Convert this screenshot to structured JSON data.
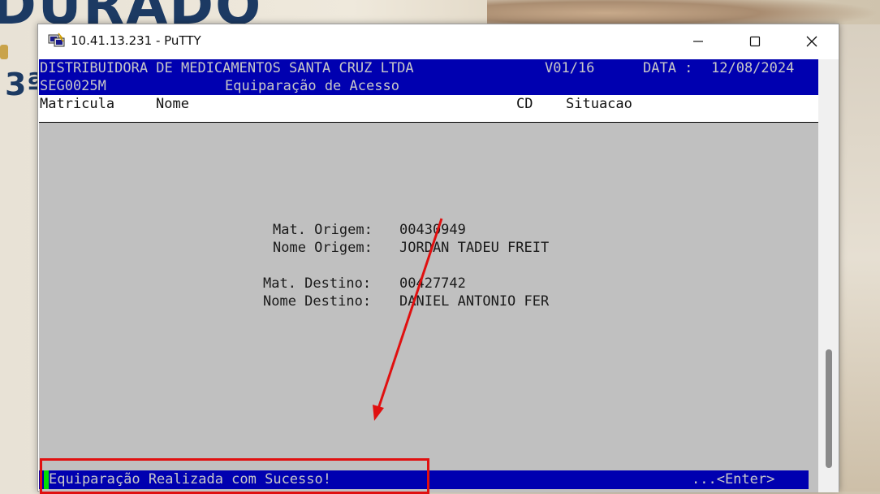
{
  "window": {
    "title": "10.41.13.231 - PuTTY",
    "app_icon": "putty-icon",
    "controls": {
      "minimize": "minimize-icon",
      "maximize": "maximize-icon",
      "close": "close-icon"
    }
  },
  "terminal": {
    "header": {
      "company": "DISTRIBUIDORA DE MEDICAMENTOS SANTA CRUZ LTDA",
      "version": "V01/16",
      "date_label": "DATA :",
      "date_value": "12/08/2024",
      "program": "SEG0025M",
      "screen_title": "Equiparação de Acesso"
    },
    "columns": [
      "Matricula",
      "Nome",
      "CD",
      "Situacao"
    ],
    "fields": {
      "mat_origem_label": "Mat. Origem:",
      "mat_origem_value": "00430949",
      "nome_origem_label": "Nome Origem:",
      "nome_origem_value": "JORDAN TADEU FREIT",
      "mat_destino_label": "Mat. Destino:",
      "mat_destino_value": "00427742",
      "nome_destino_label": "Nome Destino:",
      "nome_destino_value": "DANIEL ANTONIO FER"
    },
    "status": {
      "message": "Equiparação Realizada com Sucesso!",
      "prompt": "...<Enter>"
    }
  },
  "background": {
    "banner_text": "DURADO",
    "badge_text": "3ª"
  },
  "colors": {
    "terminal_bg": "#c0c0c0",
    "header_blue": "#0000b0",
    "annotation_red": "#e01010",
    "cursor_green": "#00e000"
  }
}
